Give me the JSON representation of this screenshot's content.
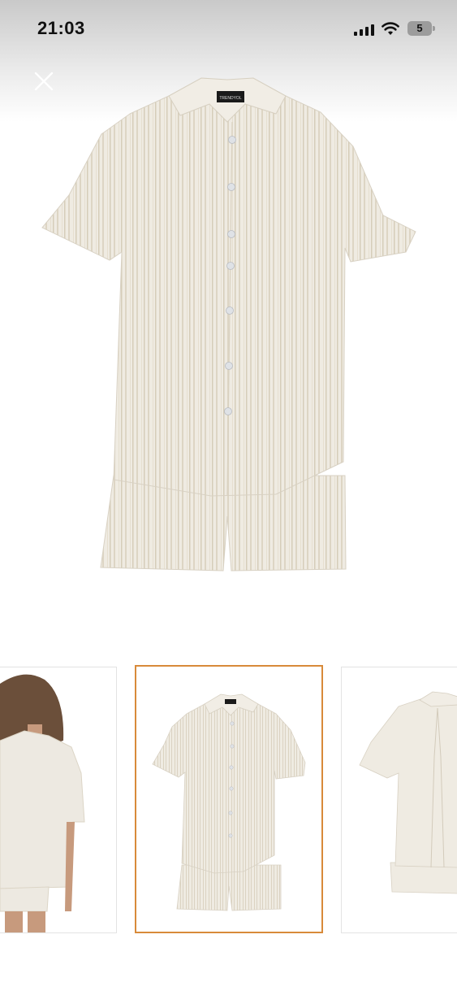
{
  "status_bar": {
    "time": "21:03",
    "battery_level": "5",
    "icons": [
      "signal-icon",
      "wifi-icon",
      "battery-icon"
    ]
  },
  "viewer": {
    "close_icon": "close-icon",
    "brand_label": "TRENDYOL",
    "selected_thumbnail_index": 1,
    "thumbnails": [
      {
        "name": "model-back-view"
      },
      {
        "name": "product-front-view"
      },
      {
        "name": "product-back-view"
      }
    ]
  },
  "colors": {
    "selected_border": "#d88a3a",
    "fabric": "#efebe2",
    "stripe": "#d9d1c0"
  }
}
